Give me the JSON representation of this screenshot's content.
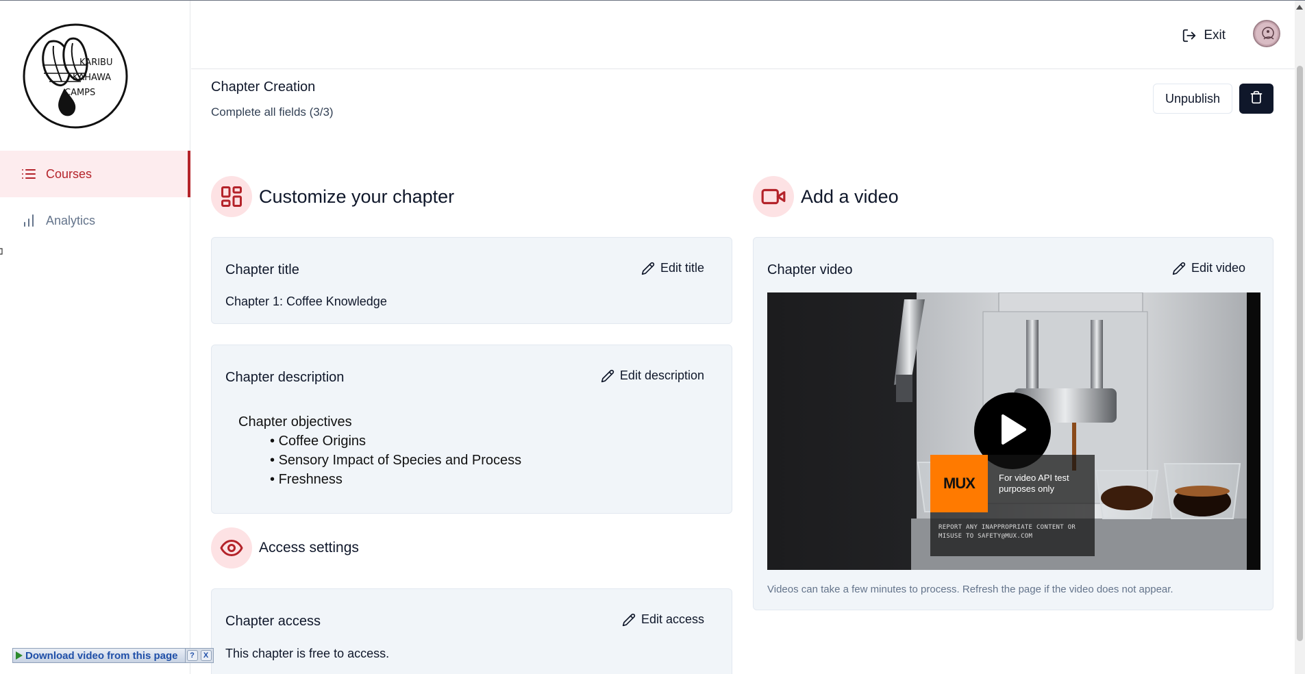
{
  "sidebar": {
    "logo_text": [
      "KARIBU",
      "KAHAWA",
      "CAMPS"
    ],
    "items": [
      {
        "label": "Courses",
        "icon": "list-icon",
        "active": true
      },
      {
        "label": "Analytics",
        "icon": "bar-chart-icon",
        "active": false
      }
    ]
  },
  "topbar": {
    "exit_label": "Exit"
  },
  "header": {
    "title": "Chapter Creation",
    "subtitle": "Complete all fields (3/3)",
    "unpublish_label": "Unpublish"
  },
  "customize": {
    "title": "Customize your chapter",
    "title_card": {
      "label": "Chapter title",
      "edit_label": "Edit title",
      "value": "Chapter 1: Coffee Knowledge"
    },
    "description_card": {
      "label": "Chapter description",
      "edit_label": "Edit description",
      "heading": "Chapter objectives",
      "bullets": [
        "Coffee Origins",
        "Sensory Impact of Species and Process",
        "Freshness"
      ]
    }
  },
  "access": {
    "title": "Access settings",
    "card": {
      "label": "Chapter access",
      "edit_label": "Edit access",
      "value": "This chapter is free to access."
    }
  },
  "video": {
    "title": "Add a video",
    "card": {
      "label": "Chapter video",
      "edit_label": "Edit video",
      "note": "Videos can take a few minutes to process. Refresh the page if the video does not appear."
    },
    "overlay": {
      "brand": "MUX",
      "purpose": "For video API test purposes only",
      "report": "REPORT ANY INAPPROPRIATE CONTENT OR MISUSE TO SAFETY@MUX.COM"
    }
  },
  "extension": {
    "download_label": "Download video from this page",
    "help_label": "?",
    "close_label": "X"
  },
  "colors": {
    "accent": "#b4232a",
    "accent_bg": "#fdecee",
    "badge_bg": "#fde2e4",
    "card_bg": "#f1f5f9",
    "dark_button": "#0f172a"
  }
}
